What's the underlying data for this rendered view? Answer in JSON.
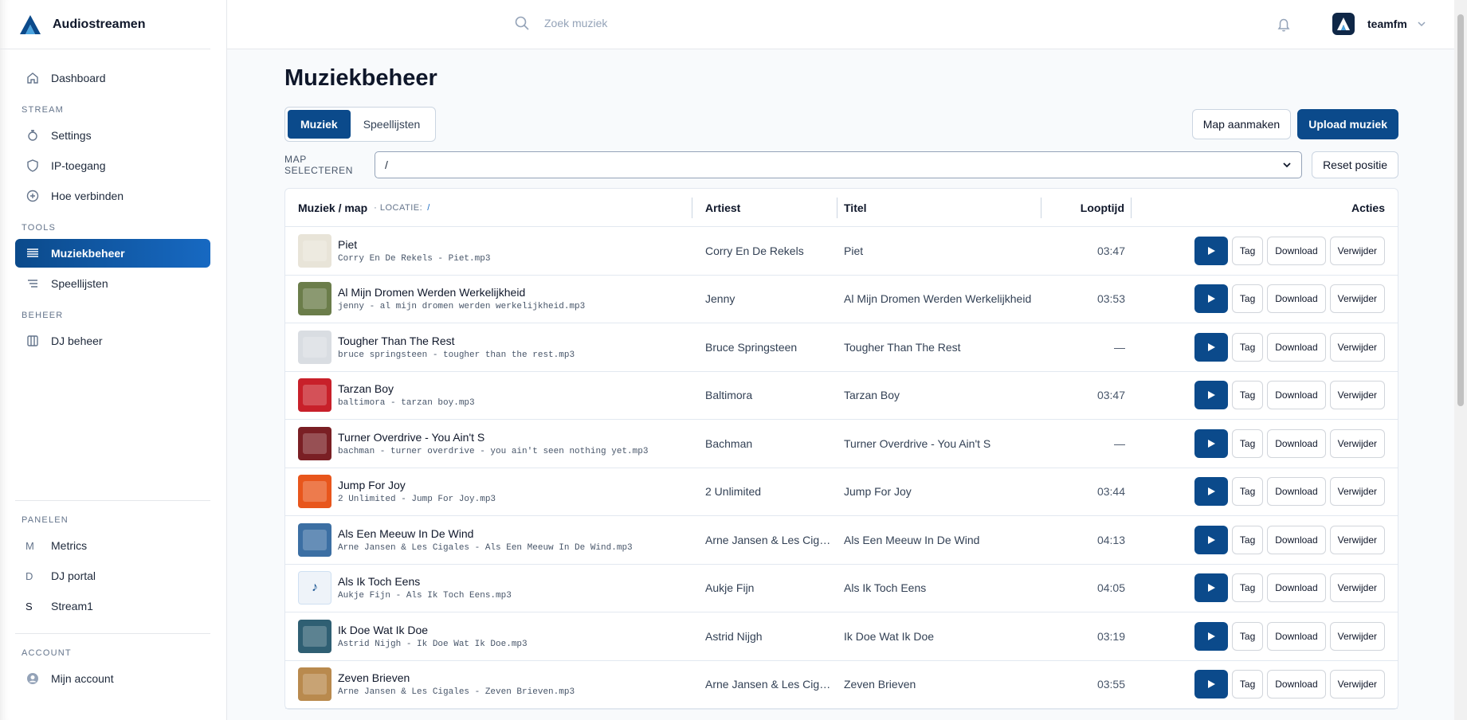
{
  "app": {
    "name": "Audiostreamen"
  },
  "sidebar": {
    "dashboard": "Dashboard",
    "sections": {
      "stream": "STREAM",
      "tools": "TOOLS",
      "beheer": "BEHEER",
      "panelen": "PANELEN",
      "account": "ACCOUNT"
    },
    "stream_items": [
      "Settings",
      "IP-toegang",
      "Hoe verbinden"
    ],
    "tools_items": [
      "Muziekbeheer",
      "Speellijsten"
    ],
    "beheer_items": [
      "DJ beheer"
    ],
    "panelen_items": [
      {
        "letter": "M",
        "label": "Metrics"
      },
      {
        "letter": "D",
        "label": "DJ portal"
      },
      {
        "letter": "S",
        "label": "Stream1"
      }
    ],
    "account_items": [
      "Mijn account"
    ]
  },
  "topbar": {
    "search_placeholder": "Zoek muziek",
    "username": "teamfm"
  },
  "page": {
    "title": "Muziekbeheer",
    "tabs": [
      "Muziek",
      "Speellijsten"
    ],
    "active_tab": "Muziek",
    "create_folder": "Map aanmaken",
    "upload": "Upload muziek",
    "map_label": "MAP SELECTEREN",
    "map_value": "/",
    "reset": "Reset positie"
  },
  "table": {
    "headers": {
      "music": "Muziek / map",
      "location_label": "LOCATIE:",
      "location_value": "/",
      "artist": "Artiest",
      "title": "Titel",
      "length": "Looptijd",
      "actions": "Acties"
    },
    "action_labels": {
      "tag": "Tag",
      "download": "Download",
      "delete": "Verwijder"
    },
    "rows": [
      {
        "title": "Piet",
        "file": "Corry En De Rekels - Piet.mp3",
        "artist": "Corry En De Rekels",
        "track": "Piet",
        "length": "03:47",
        "cover": "#e8e4d8"
      },
      {
        "title": "Al Mijn Dromen Werden Werkelijkheid",
        "file": "jenny - al mijn dromen werden werkelijkheid.mp3",
        "artist": "Jenny",
        "track": "Al Mijn Dromen Werden Werkelijkheid",
        "length": "03:53",
        "cover": "#6b7d4a"
      },
      {
        "title": "Tougher Than The Rest",
        "file": "bruce springsteen - tougher than the rest.mp3",
        "artist": "Bruce Springsteen",
        "track": "Tougher Than The Rest",
        "length": "—",
        "cover": "#d9dde2"
      },
      {
        "title": "Tarzan Boy",
        "file": "baltimora - tarzan boy.mp3",
        "artist": "Baltimora",
        "track": "Tarzan Boy",
        "length": "03:47",
        "cover": "#c8202a"
      },
      {
        "title": "Turner Overdrive - You Ain't S",
        "file": "bachman - turner overdrive - you ain't seen nothing yet.mp3",
        "artist": "Bachman",
        "track": "Turner Overdrive - You Ain't S",
        "length": "—",
        "cover": "#7a1f24"
      },
      {
        "title": "Jump For Joy",
        "file": "2 Unlimited - Jump For Joy.mp3",
        "artist": "2 Unlimited",
        "track": "Jump For Joy",
        "length": "03:44",
        "cover": "#e8561c"
      },
      {
        "title": "Als Een Meeuw In De Wind",
        "file": "Arne Jansen & Les Cigales - Als Een Meeuw In De Wind.mp3",
        "artist": "Arne Jansen & Les Cigal...",
        "track": "Als Een Meeuw In De Wind",
        "length": "04:13",
        "cover": "#3c6fa3"
      },
      {
        "title": "Als Ik Toch Eens",
        "file": "Aukje Fijn - Als Ik Toch Eens.mp3",
        "artist": "Aukje Fijn",
        "track": "Als Ik Toch Eens",
        "length": "04:05",
        "cover": "#eef3f9",
        "placeholder": true
      },
      {
        "title": "Ik Doe Wat Ik Doe",
        "file": "Astrid Nijgh - Ik Doe Wat Ik Doe.mp3",
        "artist": "Astrid Nijgh",
        "track": "Ik Doe Wat Ik Doe",
        "length": "03:19",
        "cover": "#2f5f73"
      },
      {
        "title": "Zeven Brieven",
        "file": "Arne Jansen & Les Cigales - Zeven Brieven.mp3",
        "artist": "Arne Jansen & Les Cigal...",
        "track": "Zeven Brieven",
        "length": "03:55",
        "cover": "#b98a4e"
      }
    ]
  }
}
